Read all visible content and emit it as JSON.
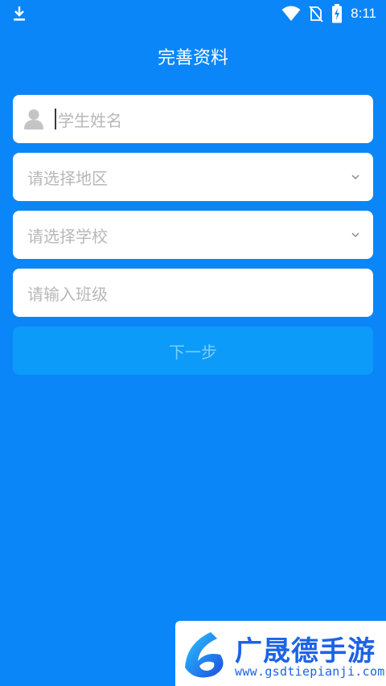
{
  "status_bar": {
    "time": "8:11",
    "icons": [
      "download-icon",
      "wifi-icon",
      "no-sim-icon",
      "battery-charging-icon"
    ]
  },
  "page": {
    "title": "完善资料"
  },
  "form": {
    "name_placeholder": "学生姓名",
    "region_placeholder": "请选择地区",
    "school_placeholder": "请选择学校",
    "class_placeholder": "请输入班级",
    "next_label": "下一步"
  },
  "watermark": {
    "name": "广晟德手游",
    "url": "www.gsdtiepianji.com"
  },
  "colors": {
    "background": "#0a86f8",
    "field_bg": "#ffffff",
    "placeholder": "#b8b8b8",
    "button_bg": "#0c9bf9",
    "button_text": "#7fcdfb",
    "watermark_text": "#1d63e6"
  }
}
